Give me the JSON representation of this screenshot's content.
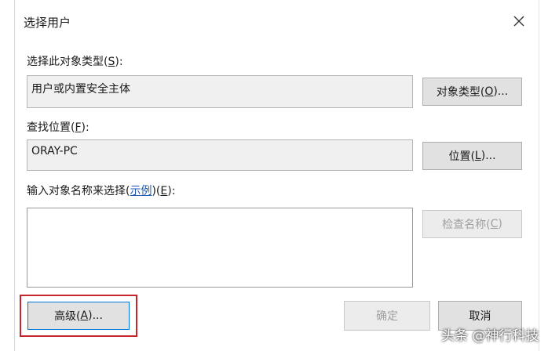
{
  "dialog": {
    "title": "选择用户"
  },
  "object_type": {
    "label_pre": "选择此对象类型(",
    "label_key": "S",
    "label_post": "):",
    "value": "用户或内置安全主体",
    "button_pre": "对象类型(",
    "button_key": "O",
    "button_post": ")..."
  },
  "location": {
    "label_pre": "查找位置(",
    "label_key": "F",
    "label_post": "):",
    "value": "ORAY-PC",
    "button_pre": "位置(",
    "button_key": "L",
    "button_post": ")..."
  },
  "names": {
    "label_pre": "输入对象名称来选择(",
    "link": "示例",
    "label_mid": ")(",
    "label_key": "E",
    "label_post": "):",
    "value": "",
    "check_pre": "检查名称(",
    "check_key": "C",
    "check_post": ")"
  },
  "footer": {
    "advanced_pre": "高级(",
    "advanced_key": "A",
    "advanced_post": ")...",
    "ok_label": "确定",
    "cancel_label": "取消"
  },
  "watermark": "头条 @神行科技"
}
